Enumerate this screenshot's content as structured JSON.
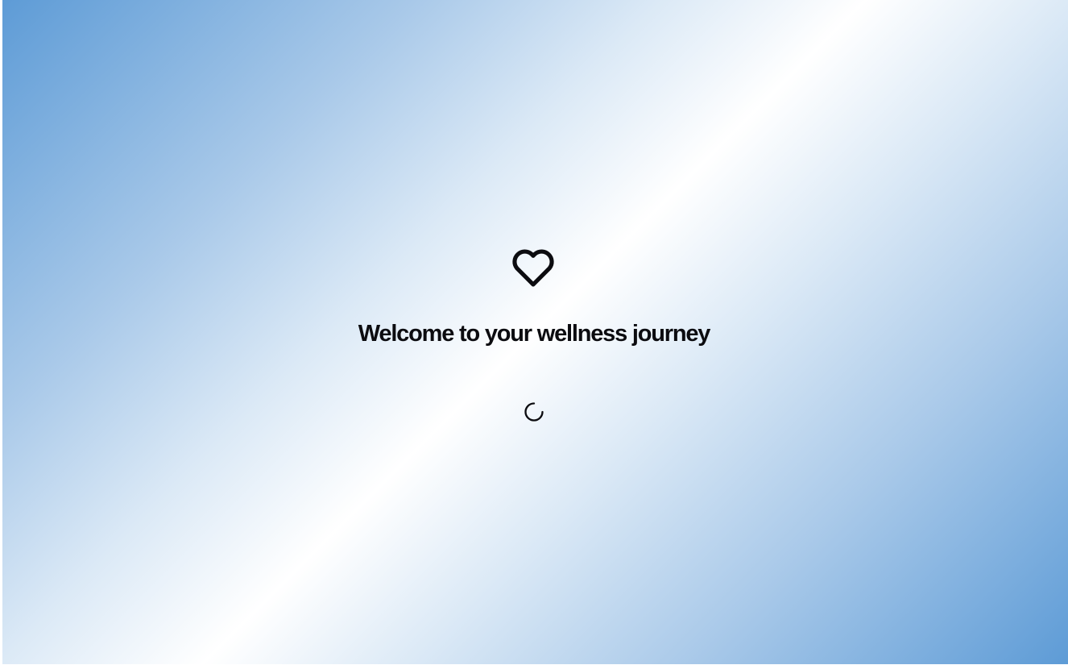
{
  "welcome": {
    "title": "Welcome to your wellness journey",
    "icon": "heart-icon",
    "loading_icon": "loading-spinner-icon"
  },
  "colors": {
    "gradient_edge": "#5d9bd6",
    "gradient_center": "#ffffff",
    "text": "#0c0c10",
    "icon_stroke": "#0c0c10"
  }
}
